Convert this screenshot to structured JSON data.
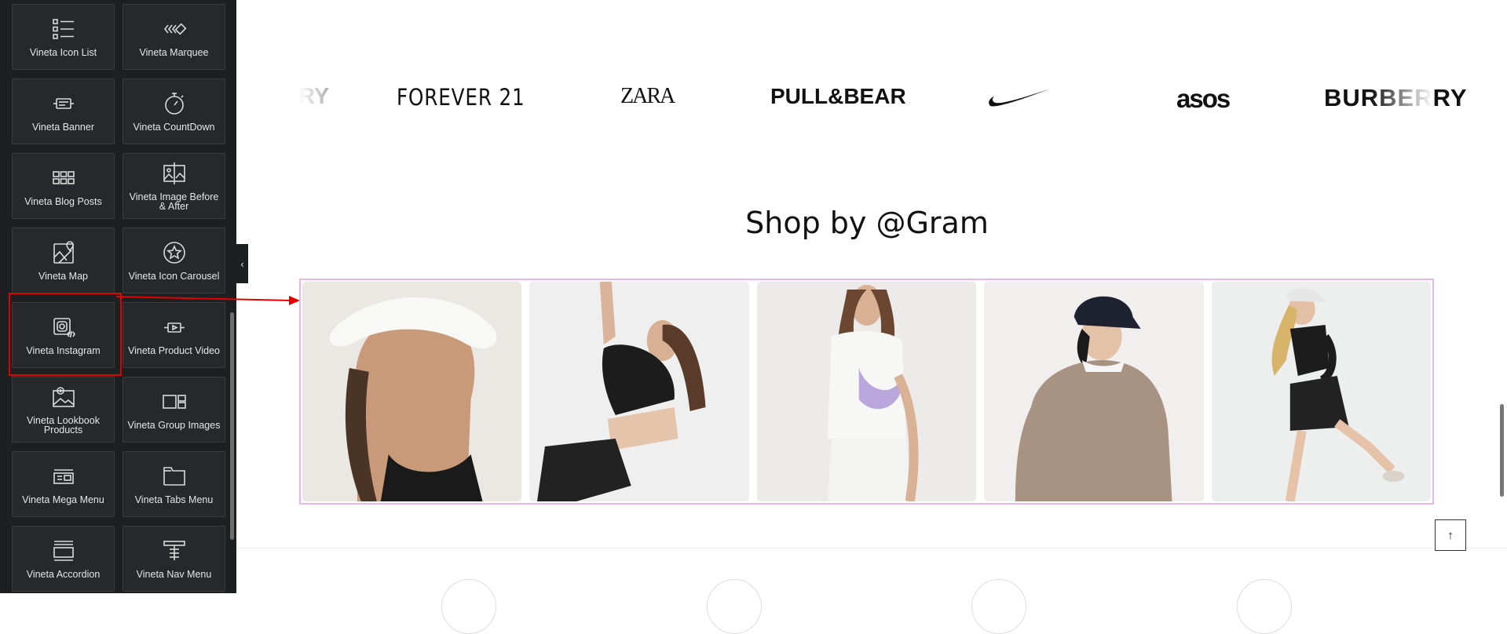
{
  "panel": {
    "widgets": [
      {
        "label": "Vineta Icon List",
        "icon": "icon-list-icon"
      },
      {
        "label": "Vineta Marquee",
        "icon": "marquee-icon"
      },
      {
        "label": "Vineta Banner",
        "icon": "banner-icon"
      },
      {
        "label": "Vineta CountDown",
        "icon": "stopwatch-icon"
      },
      {
        "label": "Vineta Blog Posts",
        "icon": "grid-posts-icon"
      },
      {
        "label": "Vineta Image Before & After",
        "icon": "image-compare-icon"
      },
      {
        "label": "Vineta Map",
        "icon": "map-icon"
      },
      {
        "label": "Vineta Icon Carousel",
        "icon": "star-circle-icon"
      },
      {
        "label": "Vineta Instagram",
        "icon": "instagram-icon"
      },
      {
        "label": "Vineta Product Video",
        "icon": "video-icon"
      },
      {
        "label": "Vineta Lookbook Products",
        "icon": "lookbook-icon"
      },
      {
        "label": "Vineta Group Images",
        "icon": "group-images-icon"
      },
      {
        "label": "Vineta Mega Menu",
        "icon": "mega-menu-icon"
      },
      {
        "label": "Vineta Tabs Menu",
        "icon": "tabs-icon"
      },
      {
        "label": "Vineta Accordion",
        "icon": "accordion-icon"
      },
      {
        "label": "Vineta Nav Menu",
        "icon": "nav-menu-icon"
      }
    ],
    "highlighted_widget": "Vineta Instagram",
    "collapse_glyph": "‹"
  },
  "brands": [
    "RY",
    "FOREVER 21",
    "ZARA",
    "PULL&BEAR",
    "nike-swoosh-logo",
    "asos",
    "BURBERRY"
  ],
  "section": {
    "title": "Shop by @Gram"
  },
  "gallery": {
    "photos": [
      "woman-white-visor",
      "woman-black-crop-top-stretching",
      "woman-white-vest-purple-bag",
      "woman-beige-sweatshirt-black-cap",
      "woman-running-black-outfit"
    ]
  },
  "back_to_top": "↑",
  "colors": {
    "panel_bg": "#1e1f21",
    "highlight": "#e00000",
    "gallery_border": "#e6b6ec"
  }
}
